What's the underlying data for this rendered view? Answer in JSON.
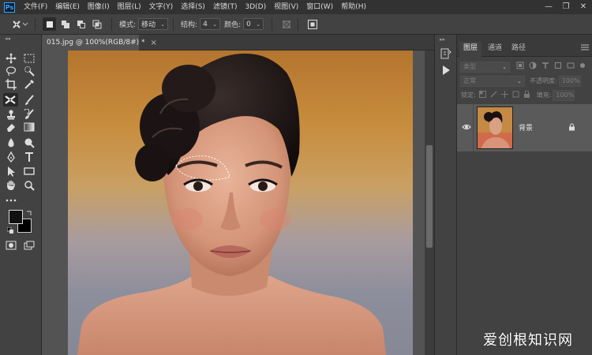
{
  "app": {
    "logo_text": "Ps"
  },
  "menubar": {
    "items": [
      {
        "label": "文件(F)"
      },
      {
        "label": "编辑(E)"
      },
      {
        "label": "图像(I)"
      },
      {
        "label": "图层(L)"
      },
      {
        "label": "文字(Y)"
      },
      {
        "label": "选择(S)"
      },
      {
        "label": "滤镜(T)"
      },
      {
        "label": "3D(D)"
      },
      {
        "label": "视图(V)"
      },
      {
        "label": "窗口(W)"
      },
      {
        "label": "帮助(H)"
      }
    ],
    "window_controls": {
      "minimize": "—",
      "restore": "❐",
      "close": "✕"
    }
  },
  "options_bar": {
    "tool_icon": "patch-tool-icon",
    "dropdown_caret": "⌄",
    "selection_modes": [
      "new-selection-icon",
      "add-selection-icon",
      "subtract-selection-icon",
      "intersect-selection-icon"
    ],
    "mode_label": "模式:",
    "mode_value": "移动",
    "structure_label": "结构:",
    "structure_value": "4",
    "color_label": "颜色:",
    "color_value": "0",
    "right_icons": [
      "sample-all-layers-icon",
      "transform-on-drop-icon"
    ]
  },
  "document": {
    "tab_title": "015.jpg @ 100%(RGB/8#) *",
    "close_glyph": "×"
  },
  "layers_panel": {
    "tabs": [
      "图层",
      "通道",
      "路径"
    ],
    "filter_placeholder": "类型",
    "blend_mode": "正常",
    "opacity_label": "不透明度:",
    "opacity_value": "100%",
    "lock_label": "锁定:",
    "fill_label": "填充:",
    "fill_value": "100%",
    "layers": [
      {
        "name": "背景",
        "visible": true,
        "locked": true
      }
    ]
  },
  "watermark": {
    "text": "爱创根知识网"
  },
  "colors": {
    "menubar_bg": "#323232",
    "panel_bg": "#424242",
    "workspace_bg": "#535353",
    "selected_layer_bg": "#5a5a5a",
    "foreground_swatch": "#000000",
    "background_swatch": "#000000"
  }
}
